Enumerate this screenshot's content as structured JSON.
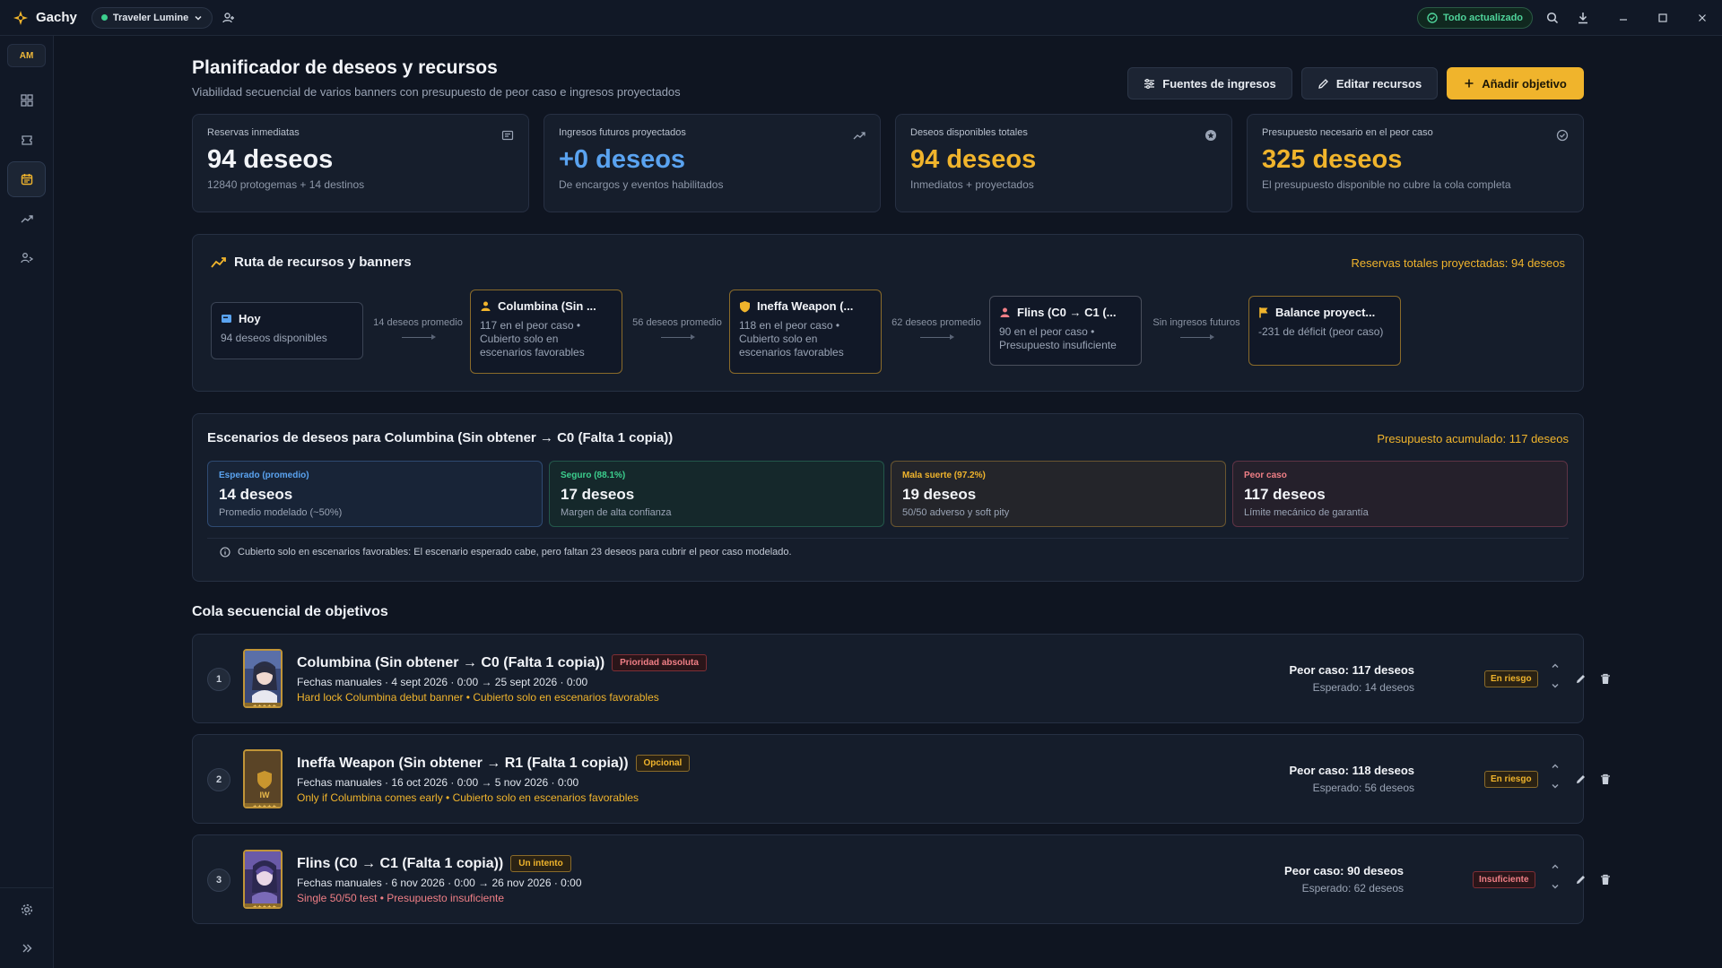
{
  "app": {
    "name": "Gachy",
    "profile": "Traveler Lumine",
    "status": "Todo actualizado",
    "avatar": "AM"
  },
  "header": {
    "title": "Planificador de deseos y recursos",
    "subtitle": "Viabilidad secuencial de varios banners con presupuesto de peor caso e ingresos proyectados",
    "btn_income": "Fuentes de ingresos",
    "btn_edit": "Editar recursos",
    "btn_add": "Añadir objetivo"
  },
  "stats": [
    {
      "label": "Reservas inmediatas",
      "value": "94 deseos",
      "note": "12840 protogemas + 14 destinos",
      "color": "#f2f4f8"
    },
    {
      "label": "Ingresos futuros proyectados",
      "value": "+0 deseos",
      "note": "De encargos y eventos habilitados",
      "color": "#5aa3f0"
    },
    {
      "label": "Deseos disponibles totales",
      "value": "94 deseos",
      "note": "Inmediatos + proyectados",
      "color": "#f0b42c"
    },
    {
      "label": "Presupuesto necesario en el peor caso",
      "value": "325 deseos",
      "note": "El presupuesto disponible no cubre la cola completa",
      "color": "#f0b42c"
    }
  ],
  "route": {
    "title": "Ruta de recursos y banners",
    "total": "Reservas totales proyectadas: 94 deseos",
    "nodes": [
      {
        "title": "Hoy",
        "desc": "94 deseos disponibles"
      },
      {
        "title": "Columbina (Sin ...",
        "desc": "117 en el peor caso • Cubierto solo en escenarios favorables"
      },
      {
        "title": "Ineffa Weapon (...",
        "desc": "118 en el peor caso • Cubierto solo en escenarios favorables"
      },
      {
        "title": "Flins (C0 → C1 (...",
        "desc": "90 en el peor caso • Presupuesto insuficiente"
      },
      {
        "title": "Balance proyect...",
        "desc": "-231 de déficit (peor caso)"
      }
    ],
    "connectors": [
      "14 deseos promedio",
      "56 deseos promedio",
      "62 deseos promedio",
      "Sin ingresos futuros"
    ]
  },
  "scenarios": {
    "title": "Escenarios de deseos para Columbina (Sin obtener → C0 (Falta 1 copia))",
    "budget": "Presupuesto acumulado: 117 deseos",
    "cards": [
      {
        "label": "Esperado (promedio)",
        "value": "14 deseos",
        "note": "Promedio modelado (~50%)",
        "color": "#5aa3f0"
      },
      {
        "label": "Seguro (88.1%)",
        "value": "17 deseos",
        "note": "Margen de alta confianza",
        "color": "#3ccf8e"
      },
      {
        "label": "Mala suerte (97.2%)",
        "value": "19 deseos",
        "note": "50/50 adverso y soft pity",
        "color": "#f0b42c"
      },
      {
        "label": "Peor caso",
        "value": "117 deseos",
        "note": "Límite mecánico de garantía",
        "color": "#f07f86"
      }
    ],
    "info": "Cubierto solo en escenarios favorables: El escenario esperado cabe, pero faltan 23 deseos para cubrir el peor caso modelado."
  },
  "queue": {
    "title": "Cola secuencial de objetivos",
    "items": [
      {
        "num": "1",
        "name": "Columbina (Sin obtener → C0 (Falta 1 copia))",
        "tag": "Prioridad absoluta",
        "dates": "Fechas manuales · 4 sept 2026 · 0:00 → 25 sept 2026 · 0:00",
        "note": "Hard lock Columbina debut banner • Cubierto solo en escenarios favorables",
        "worst": "Peor caso: 117 deseos",
        "expected": "Esperado: 14 deseos",
        "risk": "En riesgo"
      },
      {
        "num": "2",
        "name": "Ineffa Weapon (Sin obtener → R1 (Falta 1 copia))",
        "tag": "Opcional",
        "dates": "Fechas manuales · 16 oct 2026 · 0:00 → 5 nov 2026 · 0:00",
        "note": "Only if Columbina comes early • Cubierto solo en escenarios favorables",
        "worst": "Peor caso: 118 deseos",
        "expected": "Esperado: 56 deseos",
        "risk": "En riesgo",
        "thumb_text": "IW"
      },
      {
        "num": "3",
        "name": "Flins (C0 → C1 (Falta 1 copia))",
        "tag": "Un intento",
        "dates": "Fechas manuales · 6 nov 2026 · 0:00 → 26 nov 2026 · 0:00",
        "note": "Single 50/50 test • Presupuesto insuficiente",
        "worst": "Peor caso: 90 deseos",
        "expected": "Esperado: 62 deseos",
        "risk": "Insuficiente"
      }
    ]
  }
}
